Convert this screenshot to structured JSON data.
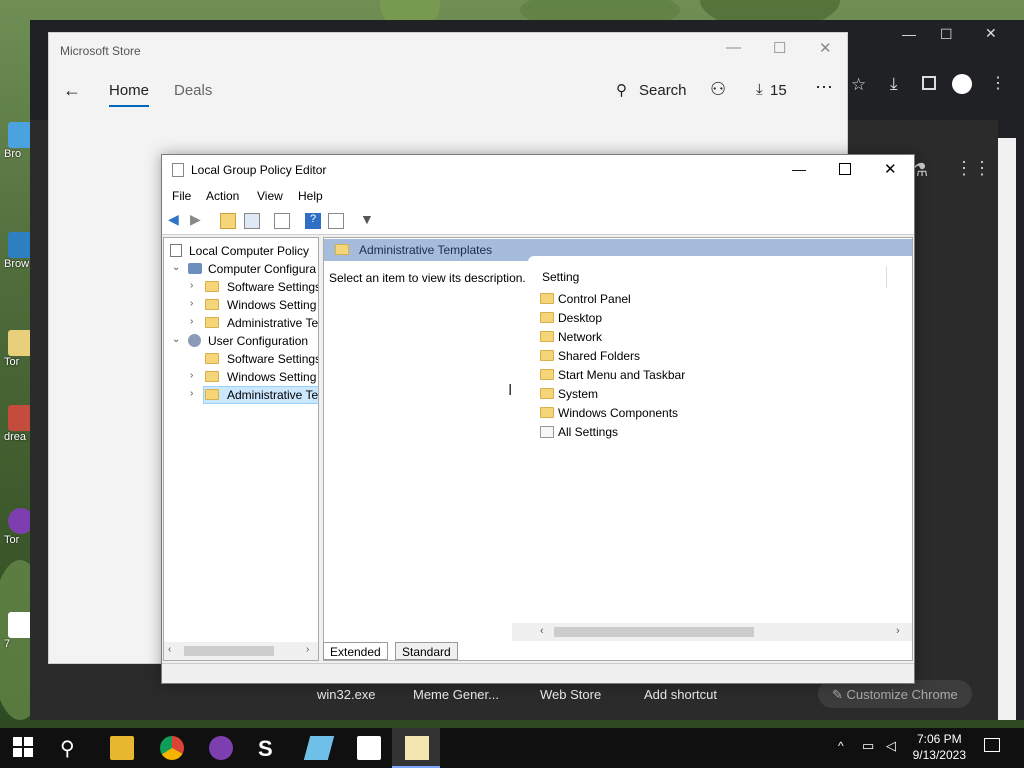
{
  "chrome": {
    "tab_count_badge": "15",
    "bookmarks": [
      "win32.exe",
      "Meme Gener...",
      "Web Store",
      "Add shortcut"
    ],
    "customize_label": "Customize Chrome"
  },
  "desktop_icons": [
    "Bro",
    "Brow Tem",
    "Tor",
    "drea",
    "Tor",
    "7"
  ],
  "store": {
    "title": "Microsoft Store",
    "nav": {
      "home": "Home",
      "deals": "Deals",
      "search": "Search",
      "downloads": "15"
    }
  },
  "gpedit": {
    "title": "Local Group Policy Editor",
    "menu": [
      "File",
      "Action",
      "View",
      "Help"
    ],
    "tree": [
      {
        "label": "Local Computer Policy",
        "level": 0,
        "expander": ""
      },
      {
        "label": "Computer Configura",
        "level": 1,
        "expander": "v"
      },
      {
        "label": "Software Settings",
        "level": 2,
        "expander": ">"
      },
      {
        "label": "Windows Setting",
        "level": 2,
        "expander": ">"
      },
      {
        "label": "Administrative Te",
        "level": 2,
        "expander": ">"
      },
      {
        "label": "User Configuration",
        "level": 1,
        "expander": "v"
      },
      {
        "label": "Software Settings",
        "level": 2,
        "expander": ""
      },
      {
        "label": "Windows Setting",
        "level": 2,
        "expander": ">"
      },
      {
        "label": "Administrative Te",
        "level": 2,
        "expander": ">",
        "selected": true
      }
    ],
    "header": "Administrative Templates",
    "description": "Select an item to view its description.",
    "column_header": "Setting",
    "items": [
      "Control Panel",
      "Desktop",
      "Network",
      "Shared Folders",
      "Start Menu and Taskbar",
      "System",
      "Windows Components",
      "All Settings"
    ],
    "tabs": [
      "Extended",
      "Standard"
    ]
  },
  "taskbar": {
    "time": "7:06 PM",
    "date": "9/13/2023"
  },
  "colors": {
    "selection": "#cce8ff",
    "header_band": "#a6bcdc",
    "store_accent": "#0067c0"
  }
}
